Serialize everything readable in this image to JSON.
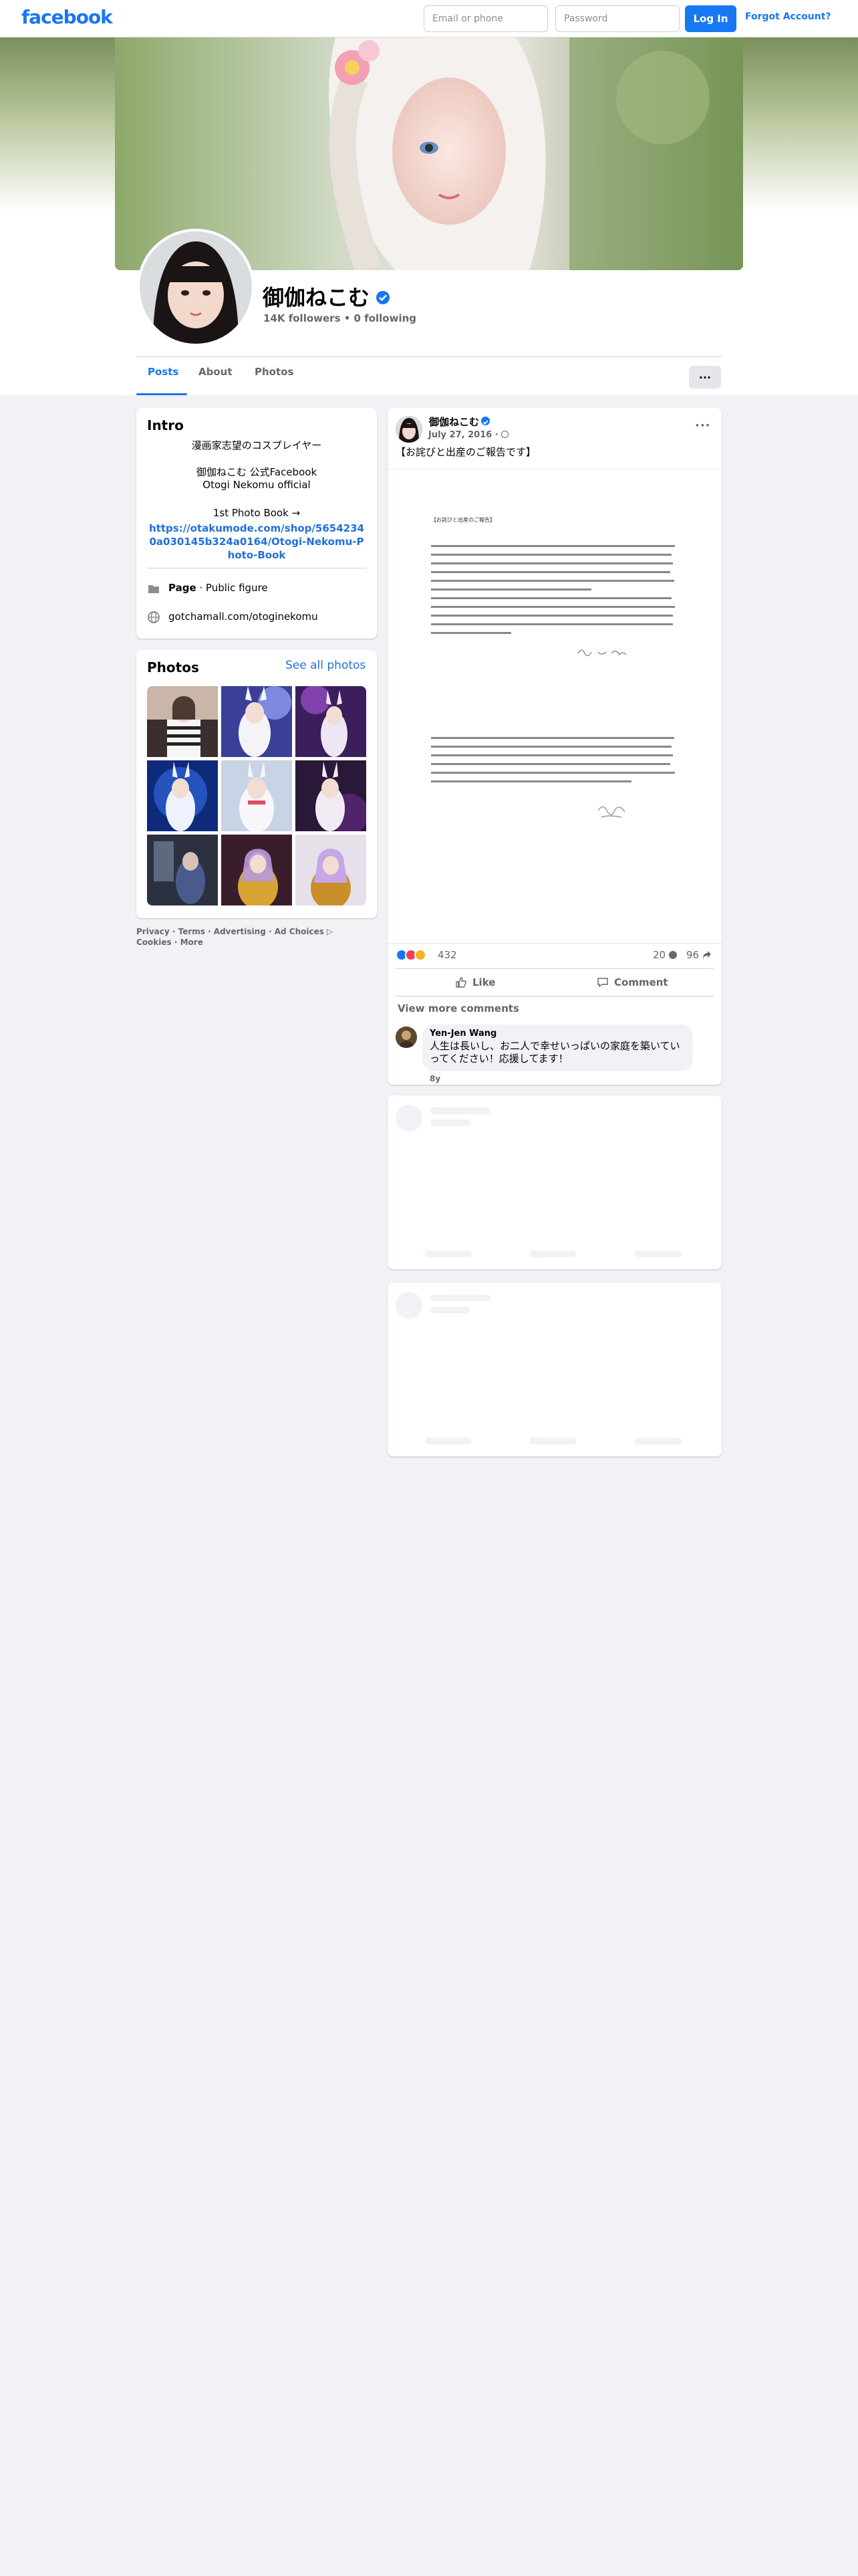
{
  "topbar": {
    "logo": "facebook",
    "email_placeholder": "Email or phone",
    "password_placeholder": "Password",
    "login_label": "Log In",
    "forgot_label": "Forgot Account?"
  },
  "profile": {
    "name": "御伽ねこむ",
    "followers": "14K followers • 0 following",
    "verified": true
  },
  "tabs": [
    {
      "label": "Posts",
      "active": true
    },
    {
      "label": "About",
      "active": false
    },
    {
      "label": "Photos",
      "active": false
    }
  ],
  "more_button": "···",
  "intro": {
    "title": "Intro",
    "bio_line1": "漫画家志望のコスプレイヤー",
    "bio_line2": "御伽ねこむ 公式Facebook",
    "bio_line3": "Otogi Nekomu official",
    "bio_line4": "1st Photo Book →",
    "link": "https://otakumode.com/shop/56542340a030145b324a0164/Otogi-Nekomu-Photo-Book",
    "page_label": "Page",
    "page_category": " · Public figure",
    "website": "gotchamall.com/otoginekomu"
  },
  "photos": {
    "title": "Photos",
    "see_all": "See all photos"
  },
  "footer": {
    "links": "Privacy · Terms · Advertising · Ad Choices ▷",
    "links2": "Cookies · More"
  },
  "post": {
    "author": "御伽ねこむ",
    "date": "July 27, 2016 · ",
    "text": "【お詫びと出産のご報告です】",
    "doc_title": "【お詫びと出産のご報告】",
    "reaction_count": "432",
    "comment_count": "20",
    "share_count": "96",
    "like_label": "Like",
    "comment_label": "Comment",
    "view_more": "View more comments",
    "comment": {
      "author": "Yen-Jen Wang",
      "body": "人生は長いし、お二人で幸せいっぱいの家庭を築いていってください！応援してます！",
      "meta": "8y"
    }
  },
  "colors": {
    "brand": "#1877f2",
    "like": "#1877f2",
    "love": "#f33e58",
    "haha": "#f7b125"
  }
}
